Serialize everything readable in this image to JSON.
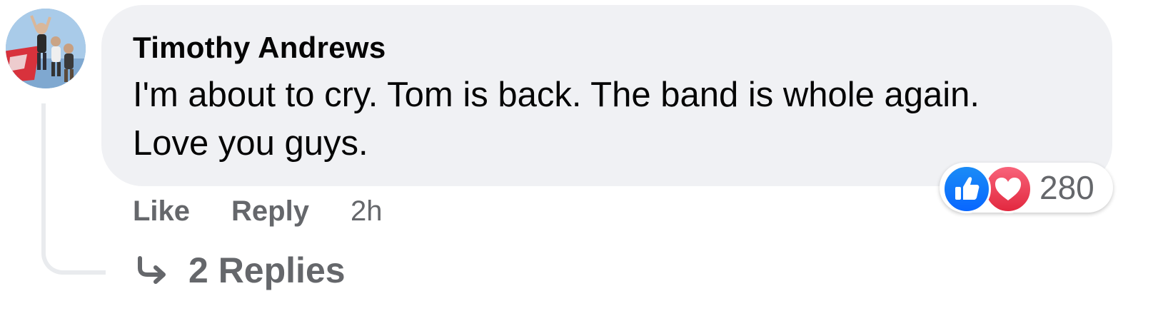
{
  "comment": {
    "author": "Timothy Andrews",
    "text_line1": "I'm about to cry. Tom is back. The band is whole again.",
    "text_line2": "Love you guys.",
    "reactions": {
      "icons": [
        "like-icon",
        "love-icon"
      ],
      "count": "280"
    },
    "actions": {
      "like_label": "Like",
      "reply_label": "Reply",
      "timestamp": "2h"
    },
    "replies_label": "2 Replies"
  },
  "colors": {
    "bubble_bg": "#f0f1f4",
    "secondary_text": "#65676b",
    "primary_text": "#050505",
    "like_blue": "#0866ff",
    "love_red": "#e2283f"
  }
}
